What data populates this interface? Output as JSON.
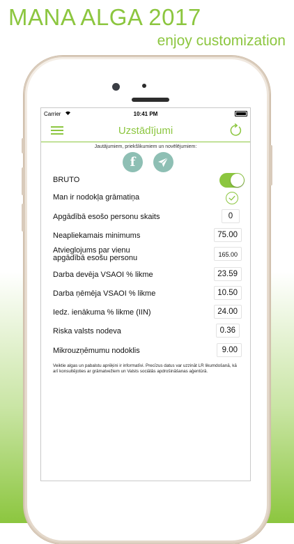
{
  "promo": {
    "title": "MANA ALGA 2017",
    "subtitle": "enjoy customization"
  },
  "statusbar": {
    "carrier": "Carrier",
    "time": "10:41 PM"
  },
  "navbar": {
    "title": "Uzstādījumi"
  },
  "feedback": {
    "hint": "Jautājumiem, priekšlikumiem un novēlējumiem:",
    "facebook_glyph": "f"
  },
  "settings": {
    "bruto_label": "BRUTO",
    "bruto_on": true,
    "tax_book_label": "Man ir nodokļa grāmatiņa",
    "tax_book_checked": true,
    "rows": [
      {
        "label": "Apgādībā esošo personu skaits",
        "value": "0"
      },
      {
        "label": "Neapliekamais minimums",
        "value": "75.00"
      },
      {
        "label": "Atvieglojums par vienu",
        "label2": "apgādībā esošu personu",
        "value": "165.00"
      },
      {
        "label": "Darba devēja VSAOI % likme",
        "value": "23.59"
      },
      {
        "label": "Darba ņēmēja VSAOI % likme",
        "value": "10.50"
      },
      {
        "label": "Iedz. ienākuma % likme (IIN)",
        "value": "24.00"
      },
      {
        "label": "Riska valsts nodeva",
        "value": "0.36"
      },
      {
        "label": "Mikrouzņēmumu nodoklis",
        "value": "9.00"
      }
    ]
  },
  "disclaimer": "Veiktie algas un pabalstu aprēķini ir informatīvi. Precīzus datus var uzzināt LR likumdošanā, kā arī konsultējoties ar grāmatvežiem un Valsts sociālās apdrošināšanas aģentūrā.",
  "colors": {
    "accent": "#8cc63f",
    "social_button": "#8ebfb4"
  }
}
